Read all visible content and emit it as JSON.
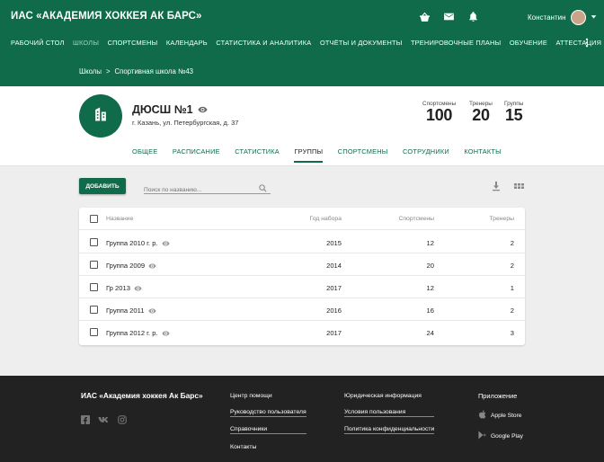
{
  "app": {
    "title": "ИАС «АКАДЕМИЯ ХОККЕЯ АК БАРС»",
    "user_name": "Константин"
  },
  "nav": {
    "items": [
      "РАБОЧИЙ СТОЛ",
      "ШКОЛЫ",
      "СПОРТСМЕНЫ",
      "КАЛЕНДАРЬ",
      "СТАТИСТИКА И АНАЛИТИКА",
      "ОТЧЁТЫ И ДОКУМЕНТЫ",
      "ТРЕНИРОВОЧНЫЕ ПЛАНЫ",
      "ОБУЧЕНИЕ",
      "АТТЕСТАЦИЯ"
    ],
    "active": "ШКОЛЫ",
    "more_icon": "more-vertical-icon"
  },
  "breadcrumb": {
    "items": [
      "Школы",
      "Спортивная школа №43"
    ],
    "separator": ">"
  },
  "school": {
    "name": "ДЮСШ №1",
    "address": "г. Казань, ул. Петербургская, д. 37",
    "stats": [
      {
        "label": "Спортсмены",
        "value": "100"
      },
      {
        "label": "Тренеры",
        "value": "20"
      },
      {
        "label": "Группы",
        "value": "15"
      }
    ]
  },
  "tabs": {
    "items": [
      "ОБЩЕЕ",
      "РАСПИСАНИЕ",
      "СТАТИСТИКА",
      "ГРУППЫ",
      "СПОРТСМЕНЫ",
      "СОТРУДНИКИ",
      "КОНТАКТЫ"
    ],
    "active": "ГРУППЫ"
  },
  "toolbar": {
    "add_label": "ДОБАВИТЬ",
    "search_placeholder": "Поиск по названию..."
  },
  "table": {
    "columns": [
      "Название",
      "Год набора",
      "Спортсмены",
      "Тренеры"
    ],
    "rows": [
      {
        "name": "Группа 2010 г. р.",
        "year": "2015",
        "athletes": "12",
        "coaches": "2"
      },
      {
        "name": "Группа 2009",
        "year": "2014",
        "athletes": "20",
        "coaches": "2"
      },
      {
        "name": "Гр 2013",
        "year": "2017",
        "athletes": "12",
        "coaches": "1"
      },
      {
        "name": "Группа 2011",
        "year": "2016",
        "athletes": "16",
        "coaches": "2"
      },
      {
        "name": "Группа 2012 г. р.",
        "year": "2017",
        "athletes": "24",
        "coaches": "3"
      }
    ]
  },
  "footer": {
    "title": "ИАС «Академия хоккея Ак Барс»",
    "social": [
      "facebook-icon",
      "vk-icon",
      "instagram-icon"
    ],
    "col1": [
      "Центр помощи",
      "Руководство пользователя",
      "Справочники",
      "Контакты"
    ],
    "col2": [
      "Юридическая информация",
      "Условия пользования",
      "Политика конфиденциальности"
    ],
    "app_title": "Приложение",
    "stores": [
      "Apple Store",
      "Google Play"
    ]
  },
  "colors": {
    "brand": "#0f6b4a",
    "footer_bg": "#222222",
    "page_bg": "#eeeeee"
  }
}
